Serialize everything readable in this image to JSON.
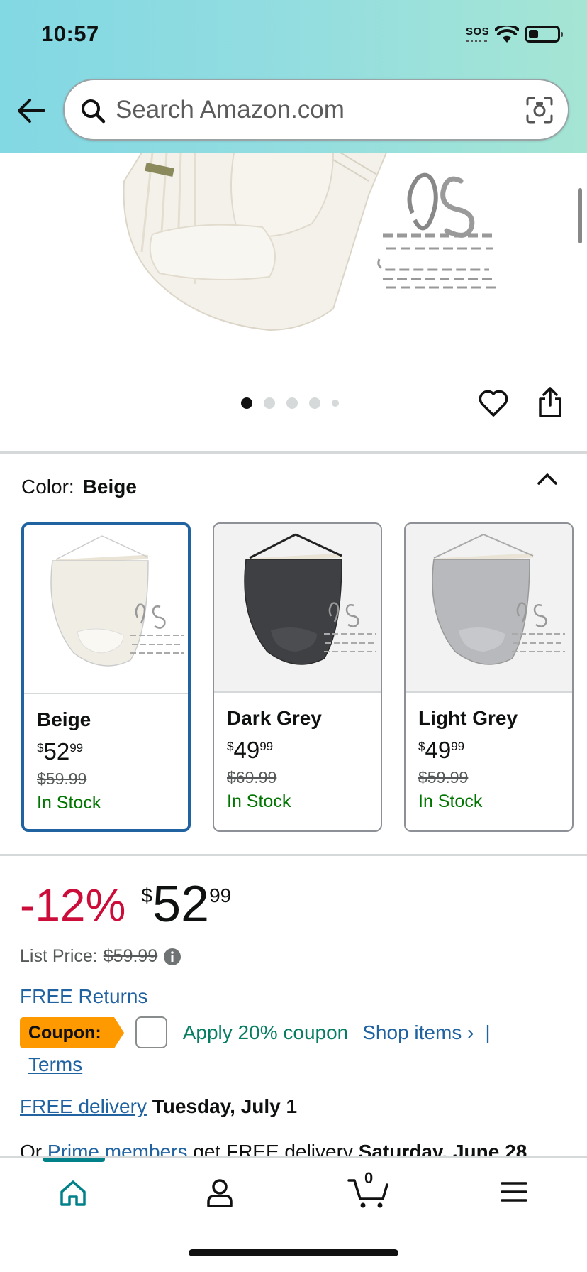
{
  "status_bar": {
    "time": "10:57",
    "sos": "SOS"
  },
  "search": {
    "placeholder": "Search Amazon.com"
  },
  "gallery": {
    "image_count": 5,
    "active_index": 0
  },
  "color": {
    "label": "Color:",
    "selected": "Beige",
    "variants": [
      {
        "name": "Beige",
        "price_symbol": "$",
        "price_whole": "52",
        "price_fraction": "99",
        "list_price": "$59.99",
        "stock": "In Stock",
        "fabric_color": "#f0ede4"
      },
      {
        "name": "Dark Grey",
        "price_symbol": "$",
        "price_whole": "49",
        "price_fraction": "99",
        "list_price": "$69.99",
        "stock": "In Stock",
        "fabric_color": "#3f4043"
      },
      {
        "name": "Light Grey",
        "price_symbol": "$",
        "price_whole": "49",
        "price_fraction": "99",
        "list_price": "$59.99",
        "stock": "In Stock",
        "fabric_color": "#b8b9bc"
      }
    ]
  },
  "price": {
    "discount": "-12%",
    "symbol": "$",
    "whole": "52",
    "fraction": "99",
    "list_label": "List Price:",
    "list_value": "$59.99"
  },
  "free_returns": "FREE Returns",
  "coupon": {
    "badge": "Coupon:",
    "apply": "Apply 20% coupon",
    "shop_items": "Shop items ›",
    "separator": "|",
    "terms": "Terms"
  },
  "delivery": {
    "link": "FREE delivery",
    "date": "Tuesday, July 1"
  },
  "prime": {
    "prefix": "Or ",
    "link": "Prime members",
    "middle": " get FREE delivery ",
    "date": "Saturday, June 28"
  },
  "tabbar": {
    "cart_count": "0"
  },
  "colors": {
    "link": "#2162a1",
    "deal": "#cc0c39",
    "stock": "#007600",
    "accent": "#00818a",
    "coupon": "#ff9900"
  }
}
